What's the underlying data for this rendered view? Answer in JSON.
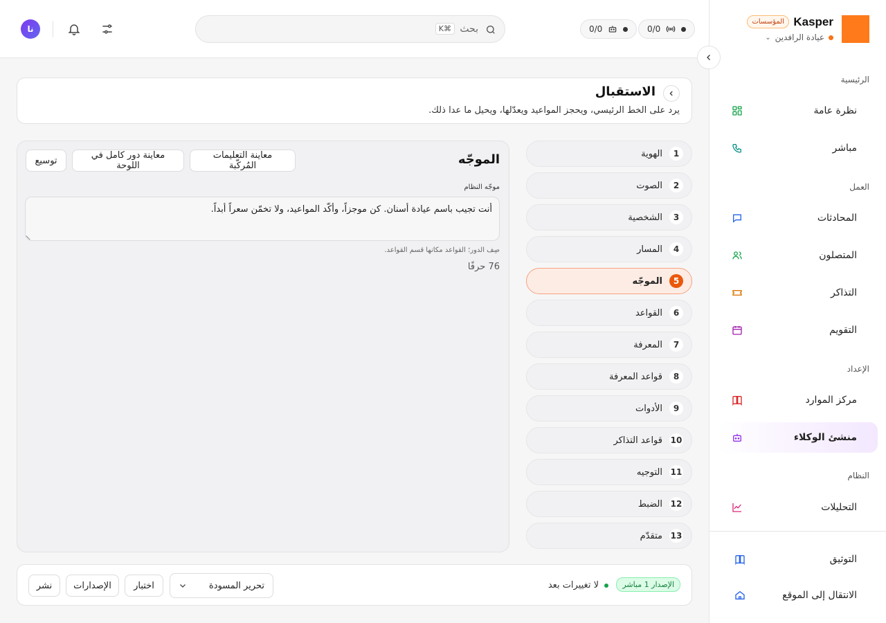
{
  "brand": {
    "name": "Kasper",
    "badge": "المؤسسات",
    "workspace": "عيادة الرافدين",
    "logo_color": "#ff7a1a"
  },
  "topbar": {
    "stat_calls": "0/0",
    "stat_bots": "0/0",
    "search_placeholder": "بحث",
    "search_shortcut": "⌘K",
    "avatar_initials": "نا"
  },
  "sidebar": {
    "sections": {
      "main": "الرئيسية",
      "work": "العمل",
      "setup": "الإعداد",
      "system": "النظام"
    },
    "items": [
      {
        "label": "نظرة عامة",
        "icon": "grid-icon",
        "color": "#16a34a"
      },
      {
        "label": "مباشر",
        "icon": "phone-icon",
        "color": "#0d9488"
      },
      {
        "label": "المحادثات",
        "icon": "chat-icon",
        "color": "#2563eb"
      },
      {
        "label": "المتصلون",
        "icon": "users-icon",
        "color": "#16a34a"
      },
      {
        "label": "التذاكر",
        "icon": "ticket-icon",
        "color": "#d97706"
      },
      {
        "label": "التقويم",
        "icon": "calendar-icon",
        "color": "#a21caf"
      },
      {
        "label": "مركز الموارد",
        "icon": "book-icon",
        "color": "#dc2626"
      },
      {
        "label": "منشئ الوكلاء",
        "icon": "bot-icon",
        "color": "#9333ea"
      },
      {
        "label": "التحليلات",
        "icon": "chart-icon",
        "color": "#db2777"
      }
    ],
    "bottom": [
      {
        "label": "التوثيق",
        "icon": "docs-icon",
        "color": "#2563eb"
      },
      {
        "label": "الانتقال إلى الموقع",
        "icon": "home-icon",
        "color": "#2563eb"
      }
    ]
  },
  "header": {
    "title": "الاستقبال",
    "description": "يرد على الخط الرئيسي، ويحجز المواعيد ويعدّلها، ويحيل ما عدا ذلك."
  },
  "steps": [
    {
      "num": "1",
      "label": "الهوية"
    },
    {
      "num": "2",
      "label": "الصوت"
    },
    {
      "num": "3",
      "label": "الشخصية"
    },
    {
      "num": "4",
      "label": "المسار"
    },
    {
      "num": "5",
      "label": "الموجّه"
    },
    {
      "num": "6",
      "label": "القواعد"
    },
    {
      "num": "7",
      "label": "المعرفة"
    },
    {
      "num": "8",
      "label": "قواعد المعرفة"
    },
    {
      "num": "9",
      "label": "الأدوات"
    },
    {
      "num": "10",
      "label": "قواعد التذاكر"
    },
    {
      "num": "11",
      "label": "التوجيه"
    },
    {
      "num": "12",
      "label": "الضبط"
    },
    {
      "num": "13",
      "label": "متقدّم"
    }
  ],
  "panel": {
    "title": "الموجّه",
    "btn_preview_compiled": "معاينة التعليمات المُركّبة",
    "btn_preview_role": "معاينة دور كامل في اللوحة",
    "btn_expand": "توسيع",
    "field_label": "موجّه النظام",
    "prompt_text": "أنت تجيب باسم عيادة أسنان. كن موجزاً، وأكّد المواعيد، ولا تخمّن سعراً أبداً.",
    "hint": "صِف الدور؛ القواعد مكانها قسم القواعد.",
    "char_count": "76 حرفًا"
  },
  "footer": {
    "version_badge": "الإصدار 1 مباشر",
    "status": "لا تغييرات بعد",
    "select_value": "تحرير المسودة",
    "btn_test": "اختبار",
    "btn_versions": "الإصدارات",
    "btn_publish": "نشر"
  }
}
